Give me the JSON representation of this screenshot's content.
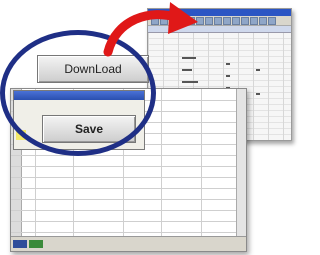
{
  "buttons": {
    "download_label": "DownLoad",
    "save_label": "Save"
  },
  "colors": {
    "ring": "#1f2f86",
    "arrow": "#e01818",
    "titlebar": "#2b55c4"
  },
  "sheet_rows": [
    {
      "num": "",
      "code": "",
      "name": "",
      "v1": "",
      "v2": ""
    },
    {
      "num": "",
      "code": "",
      "name": "",
      "v1": "",
      "v2": ""
    },
    {
      "num": "",
      "code": "",
      "name": "",
      "v1": "",
      "v2": ""
    },
    {
      "num": "",
      "code": "",
      "name": "",
      "v1": "",
      "v2": ""
    },
    {
      "num": "",
      "code": "",
      "name": "",
      "v1": "",
      "v2": ""
    },
    {
      "num": "",
      "code": "",
      "name": "",
      "v1": "",
      "v2": ""
    },
    {
      "num": "",
      "code": "",
      "name": "",
      "v1": "",
      "v2": ""
    },
    {
      "num": "",
      "code": "",
      "name": "",
      "v1": "",
      "v2": ""
    },
    {
      "num": "",
      "code": "",
      "name": "",
      "v1": "",
      "v2": ""
    },
    {
      "num": "",
      "code": "",
      "name": "",
      "v1": "",
      "v2": ""
    },
    {
      "num": "",
      "code": "",
      "name": "",
      "v1": "",
      "v2": ""
    },
    {
      "num": "",
      "code": "",
      "name": "",
      "v1": "",
      "v2": ""
    },
    {
      "num": "",
      "code": "",
      "name": "",
      "v1": "",
      "v2": ""
    }
  ]
}
